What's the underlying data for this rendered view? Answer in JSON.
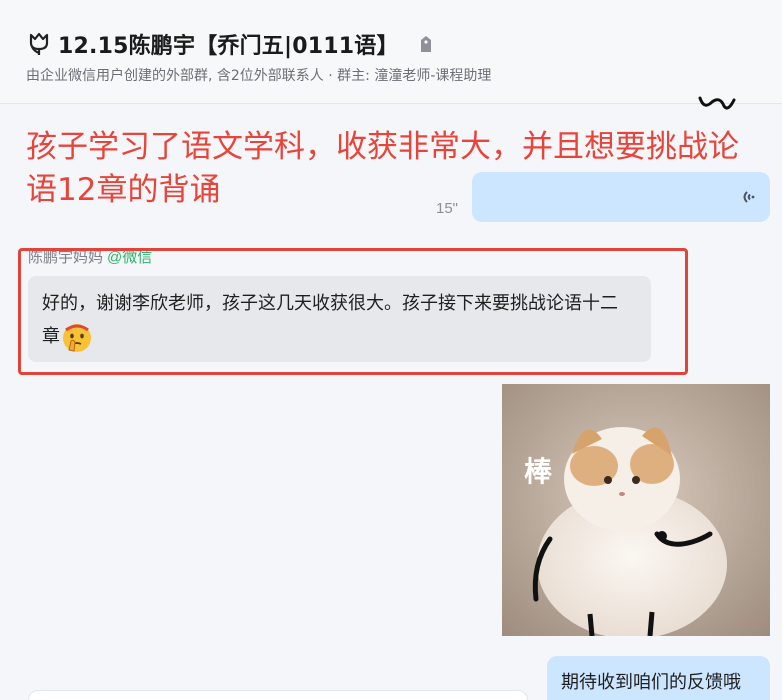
{
  "header": {
    "title": "12.15陈鹏宇【乔门五|0111语】",
    "subtitle": "由企业微信用户创建的外部群, 含2位外部联系人 · 群主: 潼潼老师-课程助理",
    "title_icon": "tulip-icon",
    "tag_icon": "tag-icon"
  },
  "annotation": {
    "text": "孩子学习了语文学科，收获非常大，并且想要挑战论语12章的背诵",
    "color": "#e8443a"
  },
  "voice_message": {
    "duration": "15\"",
    "icon": "voice-wave-icon"
  },
  "incoming": {
    "sender_name": "陈鹏宇妈妈",
    "sender_source": "@微信",
    "text": "好的，谢谢李欣老师，孩子这几天收获很大。孩子接下来要挑战论语十二章",
    "emoji": "thinking-face-emoji"
  },
  "sticker": {
    "caption": "棒"
  },
  "outgoing": {
    "text": "期待收到咱们的反馈哦"
  },
  "colors": {
    "outgoing_bubble": "#cde6ff",
    "incoming_bubble": "#e6e8ec",
    "highlight": "#e2443c"
  }
}
